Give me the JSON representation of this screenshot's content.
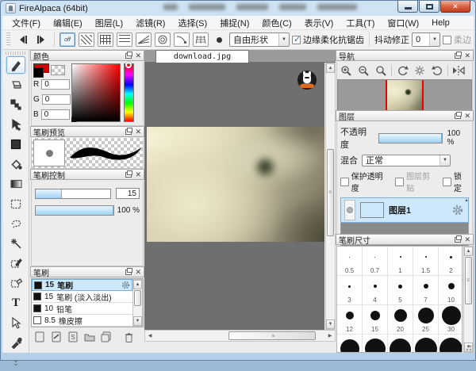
{
  "window": {
    "title": "FireAlpaca (64bit)"
  },
  "menu": {
    "items": [
      "文件(F)",
      "编辑(E)",
      "图层(L)",
      "滤镜(R)",
      "选择(S)",
      "捕捉(N)",
      "颜色(C)",
      "表示(V)",
      "工具(T)",
      "窗口(W)",
      "Help"
    ]
  },
  "toolbar": {
    "snap_off_label": "off",
    "shape_value": "自由形状",
    "antialias_label": "边缘柔化抗锯齿",
    "stabilizer_label": "抖动修正",
    "stabilizer_value": "0",
    "soft_edge_label": "柔边"
  },
  "canvas": {
    "tab": "download.jpg"
  },
  "panels": {
    "color": {
      "title": "颜色",
      "r_label": "R",
      "r_value": "0",
      "g_label": "G",
      "g_value": "0",
      "b_label": "B",
      "b_value": "0"
    },
    "brush_preview": {
      "title": "笔刷预览"
    },
    "brush_control": {
      "title": "笔刷控制",
      "size_value": "15",
      "opacity_value": "100 %"
    },
    "brush_list": {
      "title": "笔刷",
      "brushes": [
        {
          "size": "15",
          "name": "笔刷"
        },
        {
          "size": "15",
          "name": "笔刷 (淡入淡出)"
        },
        {
          "size": "10",
          "name": "铅笔"
        },
        {
          "size": "8.5",
          "name": "橡皮擦"
        }
      ]
    },
    "navigator": {
      "title": "导航"
    },
    "layers": {
      "title": "图层",
      "opacity_label": "不透明度",
      "opacity_value": "100 %",
      "blend_label": "混合",
      "blend_value": "正常",
      "check1": "保护透明度",
      "check2": "图层剪贴",
      "check3": "锁定",
      "layer1_name": "图层1"
    },
    "brush_size": {
      "title": "笔刷尺寸",
      "sizes": [
        [
          "0.5",
          "0.7",
          "1",
          "1.5",
          "2"
        ],
        [
          "3",
          "4",
          "5",
          "7",
          "10"
        ],
        [
          "12",
          "15",
          "20",
          "25",
          "30"
        ]
      ]
    }
  }
}
